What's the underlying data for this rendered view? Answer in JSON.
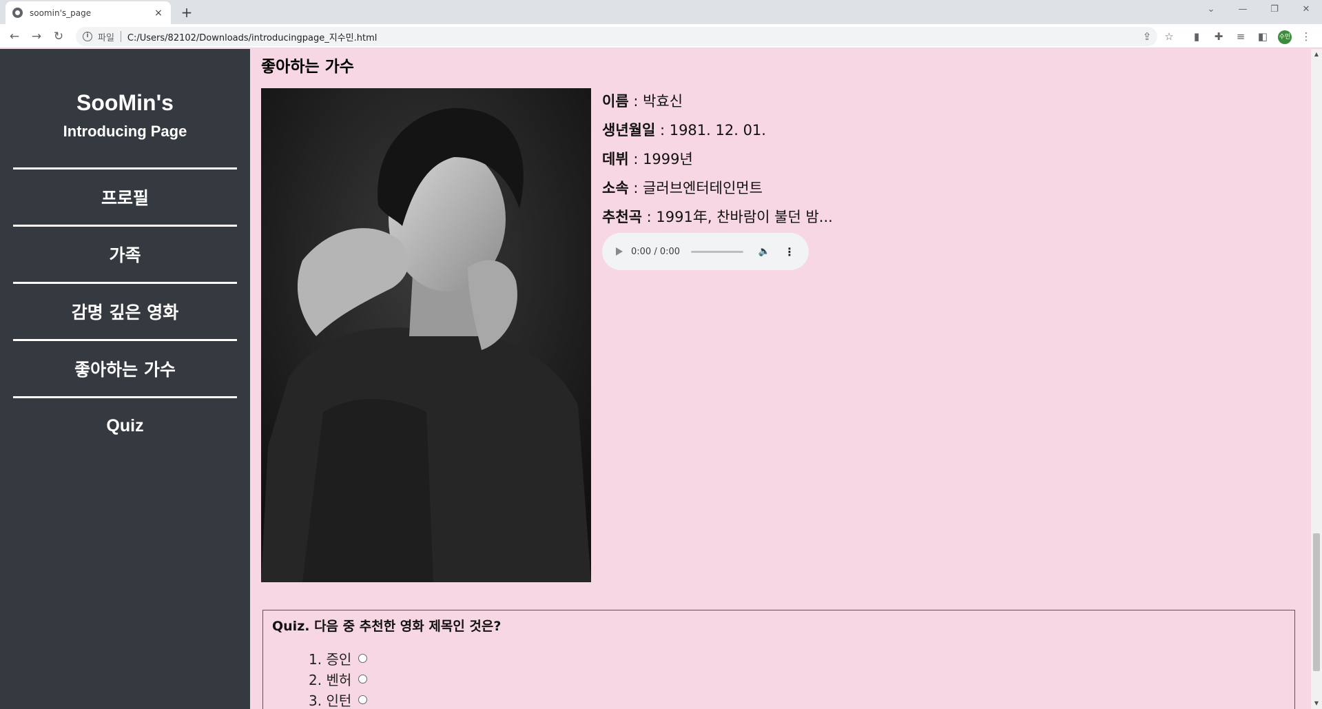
{
  "browser": {
    "tab_title": "soomin's_page",
    "close_glyph": "×",
    "newtab_glyph": "+",
    "scheme_label": "파일",
    "url": "C:/Users/82102/Downloads/introducingpage_지수민.html",
    "profile_initials": "수민"
  },
  "sidebar": {
    "title": "SooMin's",
    "subtitle": "Introducing Page",
    "items": [
      {
        "label": "프로필"
      },
      {
        "label": "가족"
      },
      {
        "label": "감명 깊은 영화"
      },
      {
        "label": "좋아하는 가수"
      },
      {
        "label": "Quiz"
      }
    ]
  },
  "singer_section": {
    "heading": "좋아하는 가수",
    "fields": [
      {
        "key": "이름",
        "value": " : 박효신"
      },
      {
        "key": "생년월일",
        "value": " : 1981. 12. 01."
      },
      {
        "key": "데뷔",
        "value": " : 1999년"
      },
      {
        "key": "소속",
        "value": " : 글러브엔터테인먼트"
      },
      {
        "key": "추천곡",
        "value": " : 1991年, 찬바람이 불던 밤..."
      }
    ],
    "audio": {
      "time": "0:00 / 0:00"
    }
  },
  "quiz": {
    "question": "Quiz. 다음 중 추천한 영화 제목인 것은?",
    "options": [
      {
        "label": "1. 증인"
      },
      {
        "label": "2. 벤허"
      },
      {
        "label": "3. 인턴"
      }
    ]
  },
  "colors": {
    "page_background": "#f7d7e3",
    "sidebar_background": "#343a40",
    "sidebar_text": "#ffffff"
  }
}
